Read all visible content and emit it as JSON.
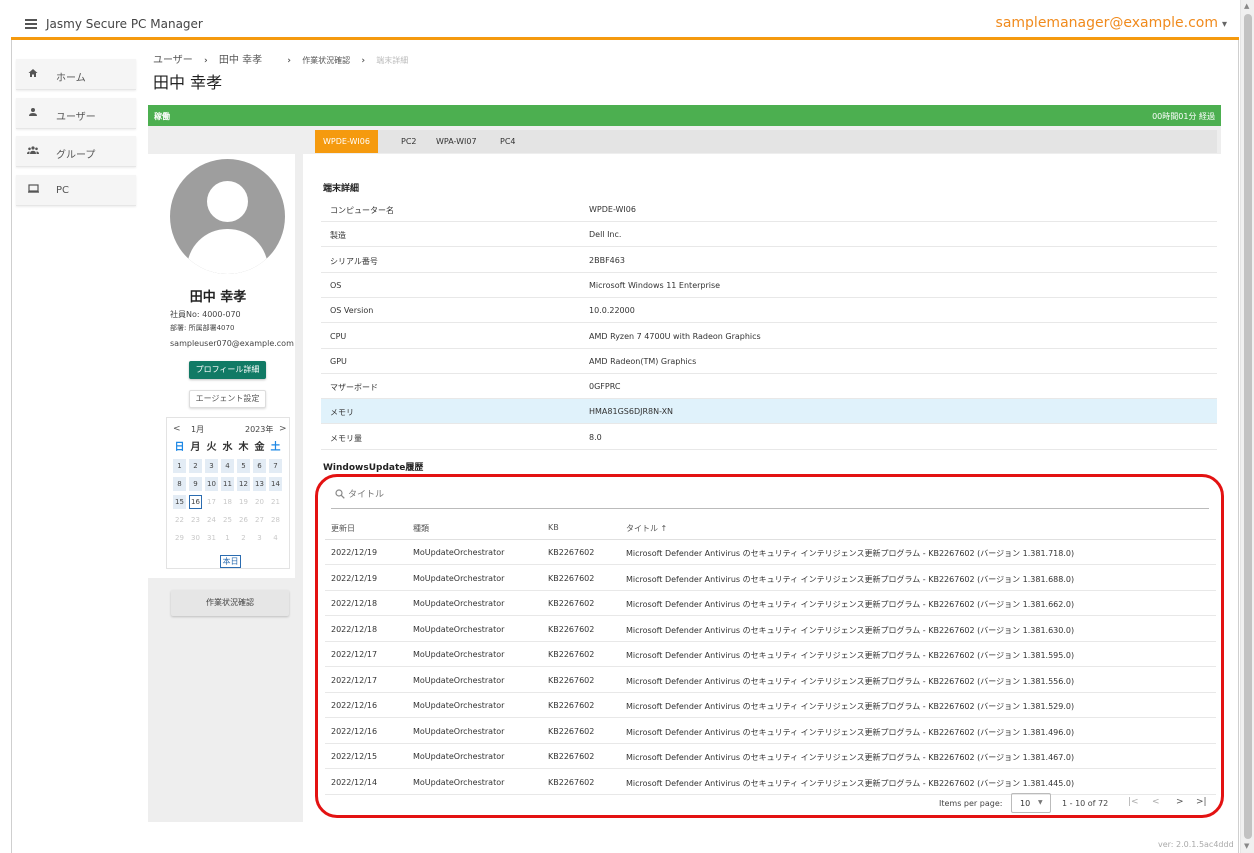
{
  "app": {
    "title": "Jasmy Secure PC Manager",
    "user_email": "samplemanager@example.com",
    "version": "ver: 2.0.1.5ac4ddd"
  },
  "icons": {
    "menu": "hamburger-icon",
    "home": "home-icon",
    "user": "user-icon",
    "group": "group-icon",
    "pc": "monitor-icon",
    "search": "search-icon"
  },
  "colors": {
    "accent": "#f59a0e",
    "status": "#4caf50",
    "primary_button": "#117a65",
    "highlight": "#e31212"
  },
  "sidebar": {
    "items": [
      {
        "label": "ホーム"
      },
      {
        "label": "ユーザー"
      },
      {
        "label": "グループ"
      },
      {
        "label": "PC"
      }
    ]
  },
  "breadcrumb": {
    "items": [
      "ユーザー",
      "田中 幸孝",
      "作業状況確認",
      "端末詳細"
    ],
    "sep": "›"
  },
  "page": {
    "title": "田中 幸孝"
  },
  "status": {
    "label": "稼働",
    "elapsed": "00時間01分 経過"
  },
  "profile": {
    "name": "田中 幸孝",
    "employee_no": "社員No: 4000-070",
    "department": "部署: 所属部署4070",
    "email": "sampleuser070@example.com",
    "profile_button": "プロフィール詳細",
    "agent_button": "エージェント設定",
    "work_button": "作業状況確認"
  },
  "calendar": {
    "prev": "<",
    "next": ">",
    "month": "1月",
    "year": "2023年",
    "weekdays": [
      "日",
      "月",
      "火",
      "水",
      "木",
      "金",
      "土"
    ],
    "days": [
      [
        "1",
        "2",
        "3",
        "4",
        "5",
        "6",
        "7"
      ],
      [
        "8",
        "9",
        "10",
        "11",
        "12",
        "13",
        "14"
      ],
      [
        "15",
        "16",
        "17",
        "18",
        "19",
        "20",
        "21"
      ],
      [
        "22",
        "23",
        "24",
        "25",
        "26",
        "27",
        "28"
      ],
      [
        "29",
        "30",
        "31",
        "1",
        "2",
        "3",
        "4"
      ]
    ],
    "today_label": "本日"
  },
  "pc_tabs": [
    "WPDE-WI06",
    "PC2",
    "WPA-WI07",
    "PC4"
  ],
  "detail": {
    "title": "端末詳細",
    "rows": [
      {
        "key": "コンピューター名",
        "value": "WPDE-WI06"
      },
      {
        "key": "製造",
        "value": "Dell Inc."
      },
      {
        "key": "シリアル番号",
        "value": "2BBF463"
      },
      {
        "key": "OS",
        "value": "Microsoft Windows 11 Enterprise"
      },
      {
        "key": "OS Version",
        "value": "10.0.22000"
      },
      {
        "key": "CPU",
        "value": "AMD Ryzen 7 4700U with Radeon Graphics"
      },
      {
        "key": "GPU",
        "value": "AMD Radeon(TM) Graphics"
      },
      {
        "key": "マザーボード",
        "value": "0GFPRC"
      },
      {
        "key": "メモリ",
        "value": "HMA81GS6DJR8N-XN"
      },
      {
        "key": "メモリ量",
        "value": "8.0"
      }
    ]
  },
  "wu": {
    "title": "WindowsUpdate履歴",
    "search_placeholder": "タイトル",
    "columns": [
      "更新日",
      "種類",
      "KB",
      "タイトル ↑"
    ],
    "rows": [
      [
        "2022/12/19",
        "MoUpdateOrchestrator",
        "KB2267602",
        "Microsoft Defender Antivirus のセキュリティ インテリジェンス更新プログラム - KB2267602 (バージョン 1.381.718.0)"
      ],
      [
        "2022/12/19",
        "MoUpdateOrchestrator",
        "KB2267602",
        "Microsoft Defender Antivirus のセキュリティ インテリジェンス更新プログラム - KB2267602 (バージョン 1.381.688.0)"
      ],
      [
        "2022/12/18",
        "MoUpdateOrchestrator",
        "KB2267602",
        "Microsoft Defender Antivirus のセキュリティ インテリジェンス更新プログラム - KB2267602 (バージョン 1.381.662.0)"
      ],
      [
        "2022/12/18",
        "MoUpdateOrchestrator",
        "KB2267602",
        "Microsoft Defender Antivirus のセキュリティ インテリジェンス更新プログラム - KB2267602 (バージョン 1.381.630.0)"
      ],
      [
        "2022/12/17",
        "MoUpdateOrchestrator",
        "KB2267602",
        "Microsoft Defender Antivirus のセキュリティ インテリジェンス更新プログラム - KB2267602 (バージョン 1.381.595.0)"
      ],
      [
        "2022/12/17",
        "MoUpdateOrchestrator",
        "KB2267602",
        "Microsoft Defender Antivirus のセキュリティ インテリジェンス更新プログラム - KB2267602 (バージョン 1.381.556.0)"
      ],
      [
        "2022/12/16",
        "MoUpdateOrchestrator",
        "KB2267602",
        "Microsoft Defender Antivirus のセキュリティ インテリジェンス更新プログラム - KB2267602 (バージョン 1.381.529.0)"
      ],
      [
        "2022/12/16",
        "MoUpdateOrchestrator",
        "KB2267602",
        "Microsoft Defender Antivirus のセキュリティ インテリジェンス更新プログラム - KB2267602 (バージョン 1.381.496.0)"
      ],
      [
        "2022/12/15",
        "MoUpdateOrchestrator",
        "KB2267602",
        "Microsoft Defender Antivirus のセキュリティ インテリジェンス更新プログラム - KB2267602 (バージョン 1.381.467.0)"
      ],
      [
        "2022/12/14",
        "MoUpdateOrchestrator",
        "KB2267602",
        "Microsoft Defender Antivirus のセキュリティ インテリジェンス更新プログラム - KB2267602 (バージョン 1.381.445.0)"
      ]
    ],
    "paginator": {
      "label": "Items per page:",
      "page_size": "10",
      "range": "1 - 10 of 72",
      "first": "|<",
      "prev": "<",
      "next": ">",
      "last": ">|"
    }
  }
}
